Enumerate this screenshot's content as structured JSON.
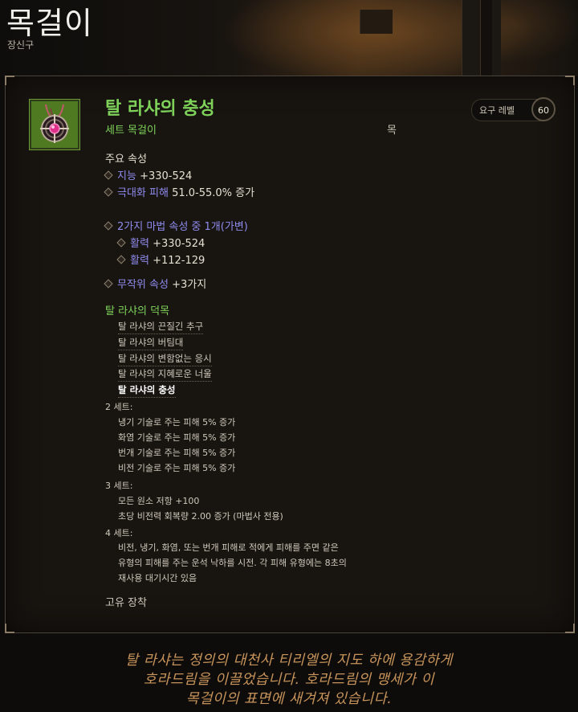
{
  "header": {
    "title": "목걸이",
    "subtitle": "장신구"
  },
  "item": {
    "name": "탈 라샤의 충성",
    "type": "세트 목걸이",
    "slot": "목",
    "required_level_label": "요구 레벨",
    "required_level": "60",
    "icon": "amulet-icon"
  },
  "primary": {
    "heading": "주요 속성",
    "stats": [
      {
        "name": "지능",
        "value": "+330-524"
      },
      {
        "name": "극대화 피해",
        "value": "51.0-55.0% 증가"
      }
    ]
  },
  "magic": {
    "line": "2가지 마법 속성 중 1개(가변)",
    "options": [
      {
        "name": "활력",
        "value": "+330-524"
      },
      {
        "name": "활력",
        "value": "+112-129"
      }
    ],
    "random": {
      "name": "무작위 속성",
      "value": "+3가지"
    }
  },
  "set": {
    "name": "탈 라샤의 덕목",
    "pieces": [
      "탈 라샤의 끈질긴 추구",
      "탈 라샤의 버팀대",
      "탈 라샤의 변함없는 응시",
      "탈 라샤의 지혜로운 너울",
      "탈 라샤의 충성"
    ],
    "bonuses": [
      {
        "label": "2 세트:",
        "lines": [
          "냉기 기술로 주는 피해 5% 증가",
          "화염 기술로 주는 피해 5% 증가",
          "번개 기술로 주는 피해 5% 증가",
          "비전 기술로 주는 피해 5% 증가"
        ]
      },
      {
        "label": "3 세트:",
        "lines": [
          "모든 원소 저항 +100",
          "초당 비전력 회복량 2.00 증가 (마법사 전용)"
        ]
      },
      {
        "label": "4 세트:",
        "lines": [
          "비전, 냉기, 화염, 또는 번개 피해로 적에게 피해를 주면 같은",
          "유형의 피해를 주는 운석 낙하를 시전. 각 피해 유형에는 8초의",
          "재사용 대기시간 있음"
        ]
      }
    ]
  },
  "unique_equipped": "고유 장착",
  "flavor": [
    "탈 라샤는 정의의 대천사 티리엘의 지도 하에 용감하게",
    "호라드림을 이끌었습니다. 호라드림의 맹세가 이",
    "목걸이의 표면에 새겨져 있습니다."
  ],
  "colors": {
    "set_green": "#7ed25a",
    "magic_blue": "#8f8cf0",
    "flavor_orange": "#c7935a"
  }
}
